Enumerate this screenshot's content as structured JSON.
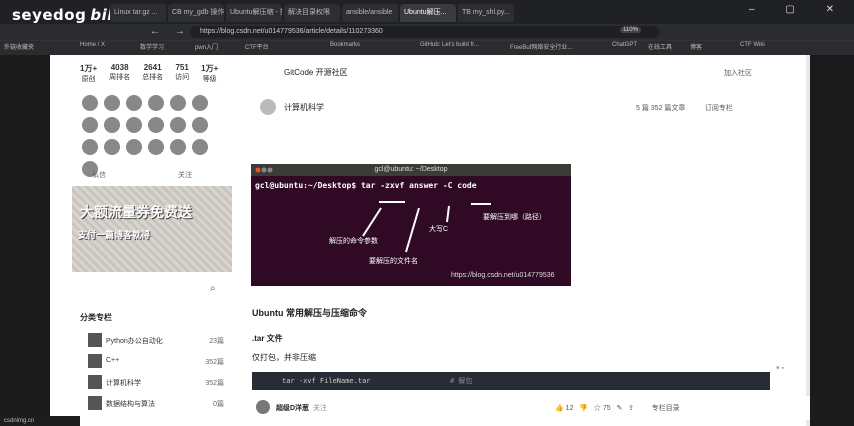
{
  "watermark": {
    "text": "seyedog",
    "brand": "bilibili"
  },
  "tabs": [
    "Linux tar.gz ...",
    "CB my_gdb 操作",
    "Ubuntu解压缩 - 搜索",
    "解决目录权限",
    "ansible/ansible",
    "Ubuntu解压...",
    "TB my_shl.py..."
  ],
  "url": "https://blog.csdn.net/u014779536/article/details/110273360",
  "zoom": "110%",
  "bookmarks": [
    "外链收藏夹",
    "Home / X",
    "数学学习",
    "pwn入门",
    "CTF平台",
    "Bookmarks",
    "GitHub: Let's build fr...",
    "FreeBuf网络安全行业...",
    "ChatGPT",
    "在线工具",
    "博客",
    "CTF Wiki"
  ],
  "stats": [
    {
      "v": "1万+",
      "l": "原创"
    },
    {
      "v": "4038",
      "l": "周排名"
    },
    {
      "v": "2641",
      "l": "总排名"
    },
    {
      "v": "751",
      "l": "访问"
    },
    {
      "v": "1万+",
      "l": "等级"
    }
  ],
  "sidebar_labels": {
    "left": "私信",
    "right": "关注"
  },
  "ad": {
    "line1": "大额流量券免费送",
    "line2": "支付一篇博客就得"
  },
  "category_title": "分类专栏",
  "categories": [
    {
      "label": "Python办公自动化",
      "count": "23篇"
    },
    {
      "label": "C++",
      "count": "352篇"
    },
    {
      "label": "计算机科学",
      "count": "352篇"
    },
    {
      "label": "数据结构与算法",
      "count": "0篇"
    }
  ],
  "community": "GitCode 开源社区",
  "follow": "加入社区",
  "channel": {
    "name": "计算机科学",
    "stats": "5 篇   352 篇文章",
    "follow": "订阅专栏"
  },
  "terminal": {
    "title": "gcl@ubuntu: ~/Desktop",
    "line": "gcl@ubuntu:~/Desktop$ tar -zxvf answer -C code",
    "anno1": "解压的命令参数",
    "anno2": "要解压的文件名",
    "anno3": "大写C",
    "anno4": "要解压到哪（路径）",
    "url": "https://blog.csdn.net/u014779536"
  },
  "article": {
    "heading": "Ubuntu 常用解压与压缩命令",
    "subheading": ".tar 文件",
    "desc": "仅打包，并非压缩",
    "code_cmd": "tar -xvf FileName.tar",
    "code_comment": "# 解包"
  },
  "author": {
    "name": "超级D洋葱",
    "follow": "关注",
    "likes": "12",
    "stars": "75",
    "actions": "专栏目录"
  },
  "status": "csdnimg.cn"
}
